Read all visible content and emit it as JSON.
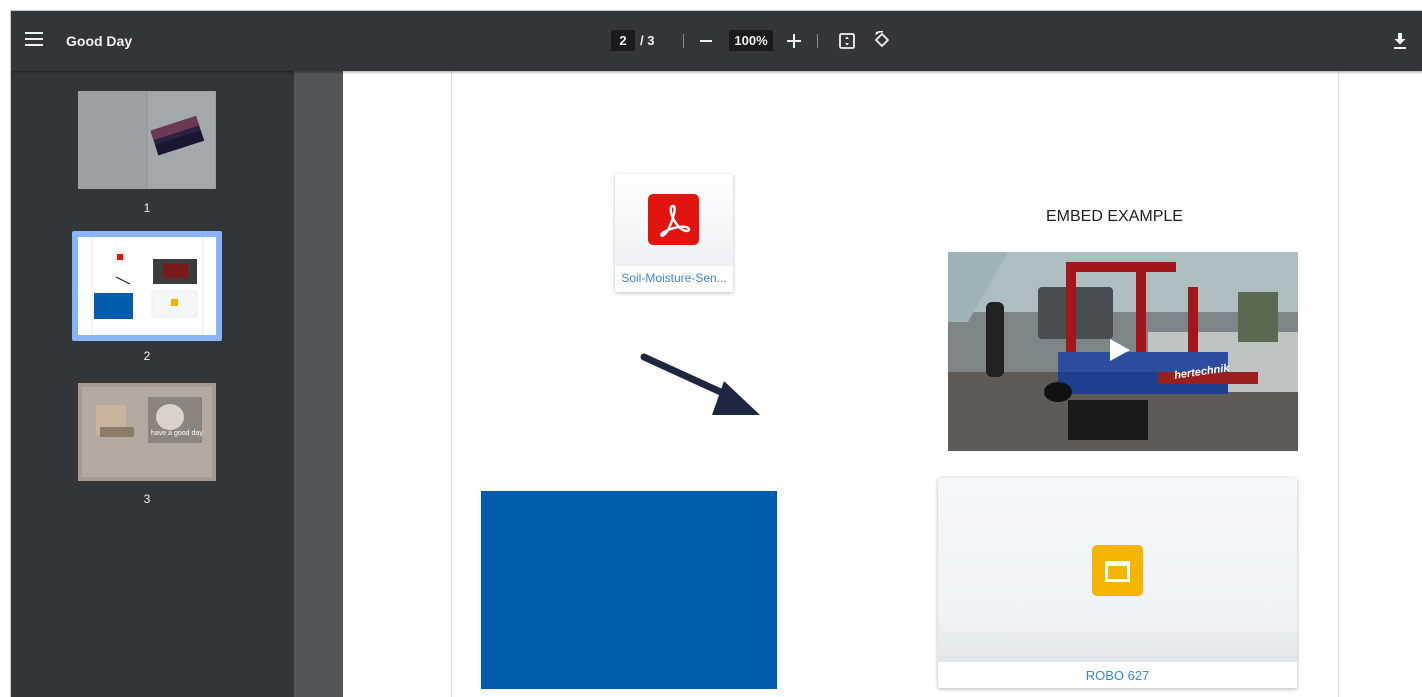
{
  "toolbar": {
    "title": "Good Day",
    "current_page": "2",
    "total_pages": "/ 3",
    "zoom": "100%"
  },
  "sidebar": {
    "thumbnails": [
      {
        "label": "1",
        "selected": false
      },
      {
        "label": "2",
        "selected": true
      },
      {
        "label": "3",
        "selected": false
      }
    ],
    "thumb3_text": "have a good day"
  },
  "page": {
    "file_name": "Soil-Moisture-Sen...",
    "embed_title": "EMBED EXAMPLE",
    "slides_name": "ROBO 627",
    "video_brand_text": "hertechnik"
  },
  "colors": {
    "toolbar_bg": "#323639",
    "viewer_bg": "#525659",
    "pdf_red": "#e2140f",
    "slides_yellow": "#f5b400",
    "block_blue": "#005cac",
    "link_blue": "#3b89d6",
    "selection_blue": "#8ab4f8"
  }
}
